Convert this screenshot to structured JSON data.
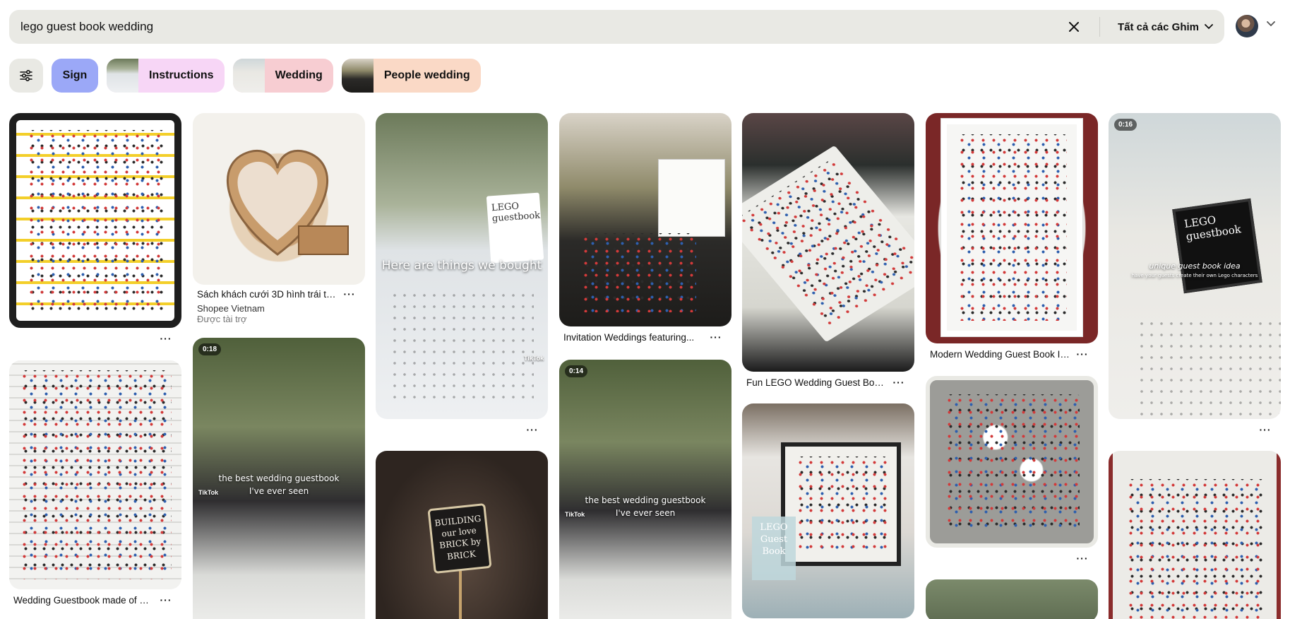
{
  "search": {
    "query": "lego guest book wedding",
    "scope_label": "Tất cả các Ghim"
  },
  "chips": [
    {
      "label": "Sign"
    },
    {
      "label": "Instructions"
    },
    {
      "label": "Wedding"
    },
    {
      "label": "People wedding"
    }
  ],
  "pins": {
    "p1": {
      "title": "",
      "more": "···"
    },
    "p2": {
      "title": "Sách khách cưới 3D hình trái tim,...",
      "subtitle": "Shopee Vietnam",
      "sponsored": "Được tài trợ",
      "more": "···"
    },
    "p3": {
      "overlay": "Here are things we bought",
      "sign": "LEGO guestbook",
      "watermark": "TikTok",
      "more": "···"
    },
    "p4": {
      "title": "Invitation Weddings featuring...",
      "more": "···"
    },
    "p5": {
      "title": "Fun LEGO Wedding Guest Book...",
      "more": "···"
    },
    "p6": {
      "title": "Modern Wedding Guest Book Ide...",
      "more": "···"
    },
    "p7": {
      "badge": "0:16",
      "sign": "LEGO guestbook",
      "caption": "unique guest book idea",
      "caption2": "have your guests create their own Lego characters",
      "more": "···"
    },
    "p8": {
      "title": "Wedding Guestbook made of LEG...",
      "more": "···"
    },
    "p9": {
      "badge": "0:18",
      "overlay": "the best wedding guestbook",
      "overlay2": "I've ever seen",
      "watermark": "TikTok"
    },
    "p10": {
      "sign_text": "BUILDING our love BRICK by BRICK"
    },
    "p11": {
      "badge": "0:14",
      "overlay": "the best wedding guestbook",
      "overlay2": "I've ever seen",
      "watermark": "TikTok"
    },
    "p12": {
      "sign_text": "LEGO Guest Book"
    },
    "p13": {
      "more": "···"
    },
    "p14": {},
    "p15": {}
  },
  "colors": {
    "search_bg": "#e9e9e4",
    "chip_sign": "#9ba8f7",
    "chip_instructions": "#f7d6f6",
    "chip_wedding": "#f7cdd2",
    "chip_people": "#fad9c6"
  },
  "icons": [
    "close-icon",
    "chevron-down-icon",
    "filter-sliders-icon",
    "more-dots-icon"
  ]
}
